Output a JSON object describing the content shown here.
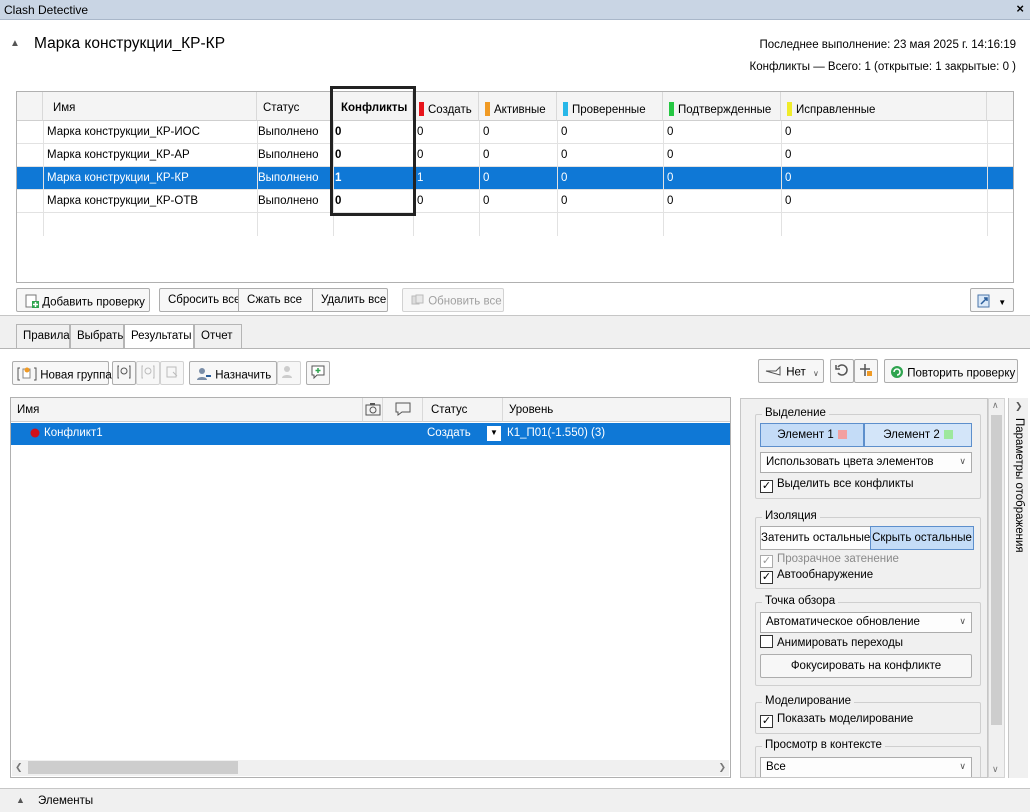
{
  "window": {
    "title": "Clash Detective",
    "close": "×"
  },
  "test": {
    "name": "Марка конструкции_КР-КР",
    "last_run": "Последнее выполнение:  23 мая 2025 г. 14:16:19",
    "summary": "Конфликты —  Всего:  1  (открытые:  1  закрытые:  0 )"
  },
  "tests_table": {
    "headers": {
      "name": "Имя",
      "status": "Статус",
      "clashes": "Конфликты",
      "new": "Создать",
      "active": "Активные",
      "reviewed": "Проверенные",
      "approved": "Подтвержденные",
      "resolved": "Исправленные"
    },
    "status_colors": {
      "new": "#e8141b",
      "active": "#f09a24",
      "reviewed": "#28b7e8",
      "approved": "#25c742",
      "resolved": "#f0ec2a"
    },
    "rows": [
      {
        "name": "Марка конструкции_КР-ИОС",
        "status": "Выполнено",
        "clashes": "0",
        "new": "0",
        "active": "0",
        "reviewed": "0",
        "approved": "0",
        "resolved": "0"
      },
      {
        "name": "Марка конструкции_КР-АР",
        "status": "Выполнено",
        "clashes": "0",
        "new": "0",
        "active": "0",
        "reviewed": "0",
        "approved": "0",
        "resolved": "0"
      },
      {
        "name": "Марка конструкции_КР-КР",
        "status": "Выполнено",
        "clashes": "1",
        "new": "1",
        "active": "0",
        "reviewed": "0",
        "approved": "0",
        "resolved": "0"
      },
      {
        "name": "Марка конструкции_КР-ОТВ",
        "status": "Выполнено",
        "clashes": "0",
        "new": "0",
        "active": "0",
        "reviewed": "0",
        "approved": "0",
        "resolved": "0"
      }
    ]
  },
  "test_buttons": {
    "add": "Добавить проверку",
    "reset_all": "Сбросить все",
    "compact_all": "Сжать все",
    "delete_all": "Удалить все",
    "update_all": "Обновить все"
  },
  "tabs": [
    "Правила",
    "Выбрать",
    "Результаты",
    "Отчет"
  ],
  "results_toolbar": {
    "new_group": "Новая группа",
    "assign": "Назначить",
    "none": "Нет",
    "rerun": "Повторить проверку"
  },
  "results_table": {
    "headers": {
      "name": "Имя",
      "status": "Статус",
      "level": "Уровень"
    },
    "rows": [
      {
        "name": "Конфликт1",
        "status": "Создать",
        "level": "К1_П01(-1.550) (3)",
        "dot_color": "#d0101a"
      }
    ]
  },
  "display": {
    "side_tab": "Параметры отображения",
    "highlighting": {
      "label": "Выделение",
      "item1": "Элемент 1",
      "item2": "Элемент 2",
      "item1_color": "#f2a0a0",
      "item2_color": "#9de89d",
      "mode": "Использовать цвета элементов",
      "highlight_all": "Выделить все конфликты"
    },
    "isolation": {
      "label": "Изоляция",
      "dim_other": "Затенить остальные",
      "hide_other": "Скрыть остальные",
      "transparent": "Прозрачное затенение",
      "auto_reveal": "Автообнаружение"
    },
    "viewpoint": {
      "label": "Точка обзора",
      "mode": "Автоматическое обновление",
      "animate": "Анимировать переходы",
      "focus": "Фокусировать на конфликте"
    },
    "simulation": {
      "label": "Моделирование",
      "show": "Показать моделирование"
    },
    "context": {
      "label": "Просмотр в контексте",
      "mode": "Все"
    }
  },
  "bottom": {
    "label": "Элементы"
  }
}
